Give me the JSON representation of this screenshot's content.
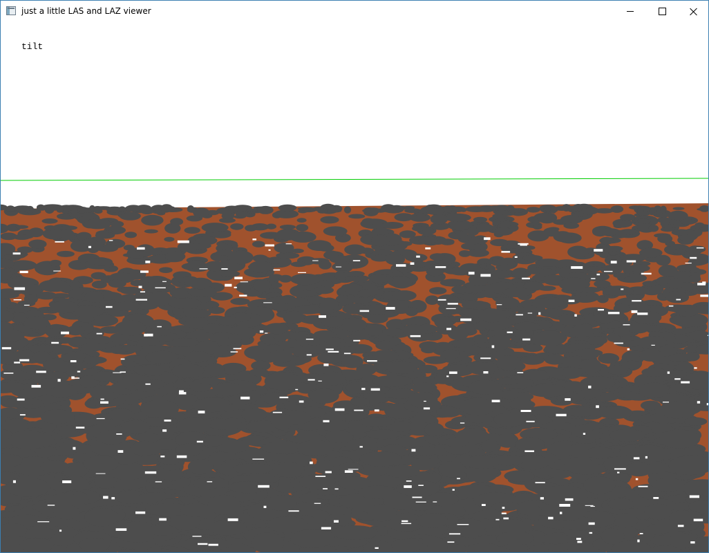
{
  "window": {
    "title": "just a little LAS and LAZ viewer",
    "app_icon": "window-app-icon",
    "controls": {
      "minimize_icon": "minimize-icon",
      "maximize_icon": "maximize-icon",
      "close_icon": "close-icon"
    }
  },
  "viewer": {
    "mode_label": "tilt",
    "colors": {
      "background": "#ffffff",
      "ground_points": "#a0522d",
      "vegetation_points": "#4d4d4d",
      "horizon_line": "#00cc00"
    }
  }
}
